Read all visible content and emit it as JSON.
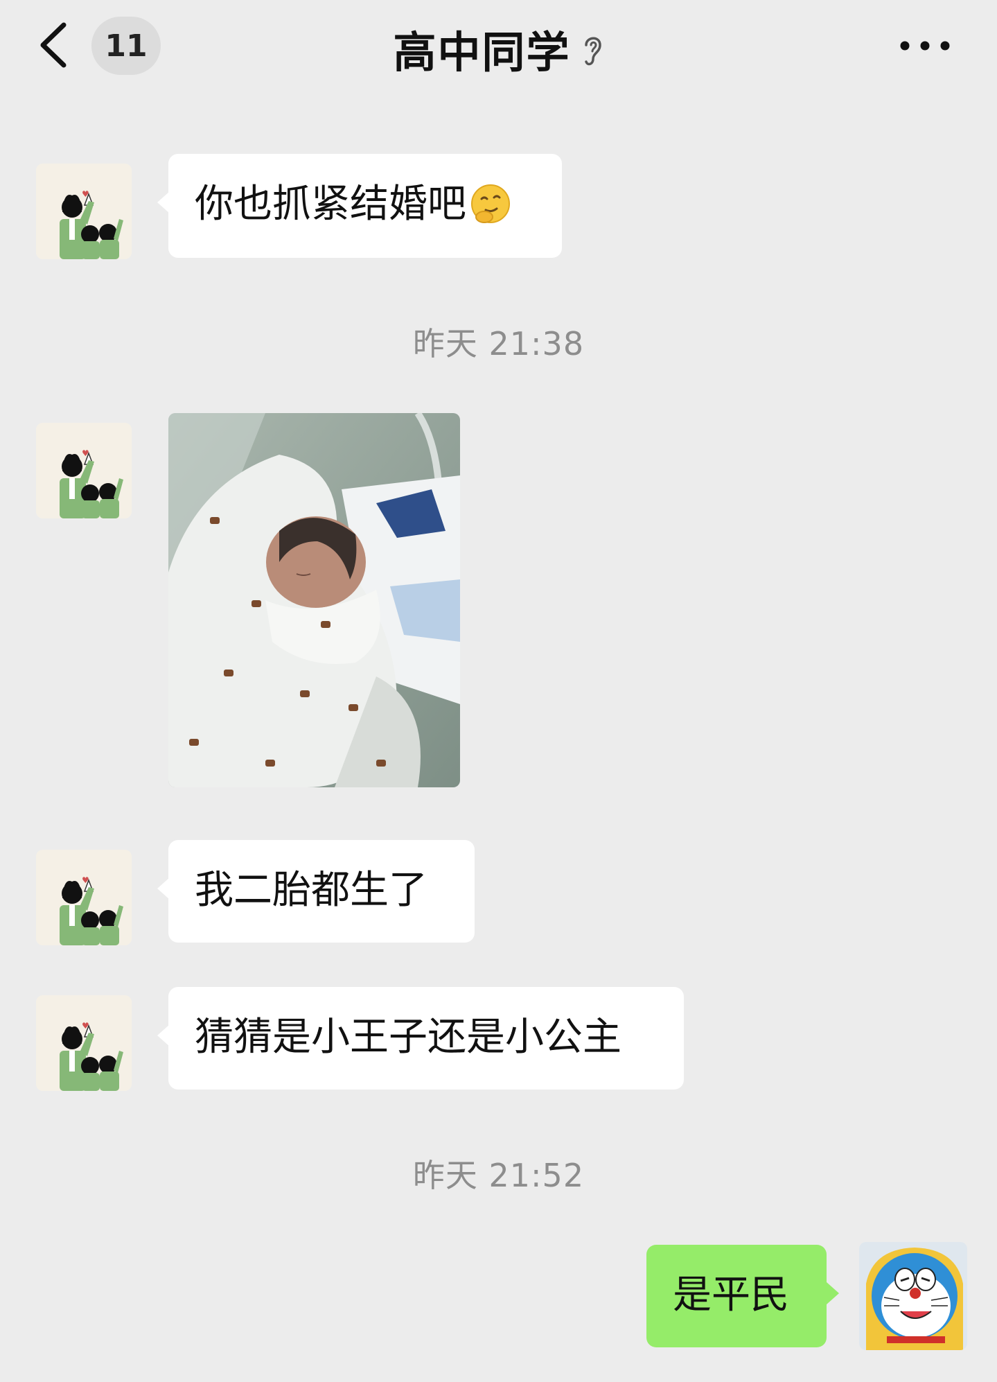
{
  "header": {
    "unread_count": "11",
    "title": "高中同学"
  },
  "messages": [
    {
      "sender": "other",
      "text": "你也抓紧结婚吧",
      "emoji": "thinking-face-icon"
    },
    {
      "type": "timestamp",
      "text": "昨天 21:38"
    },
    {
      "sender": "other",
      "type": "image",
      "image": "newborn-baby-photo"
    },
    {
      "sender": "other",
      "text": "我二胎都生了"
    },
    {
      "sender": "other",
      "text": "猜猜是小王子还是小公主"
    },
    {
      "type": "timestamp",
      "text": "昨天 21:52"
    },
    {
      "sender": "me",
      "text": "是平民"
    }
  ],
  "colors": {
    "background": "#ececec",
    "bubble_other": "#ffffff",
    "bubble_mine": "#95ec69",
    "timestamp": "#8d8d8d"
  }
}
